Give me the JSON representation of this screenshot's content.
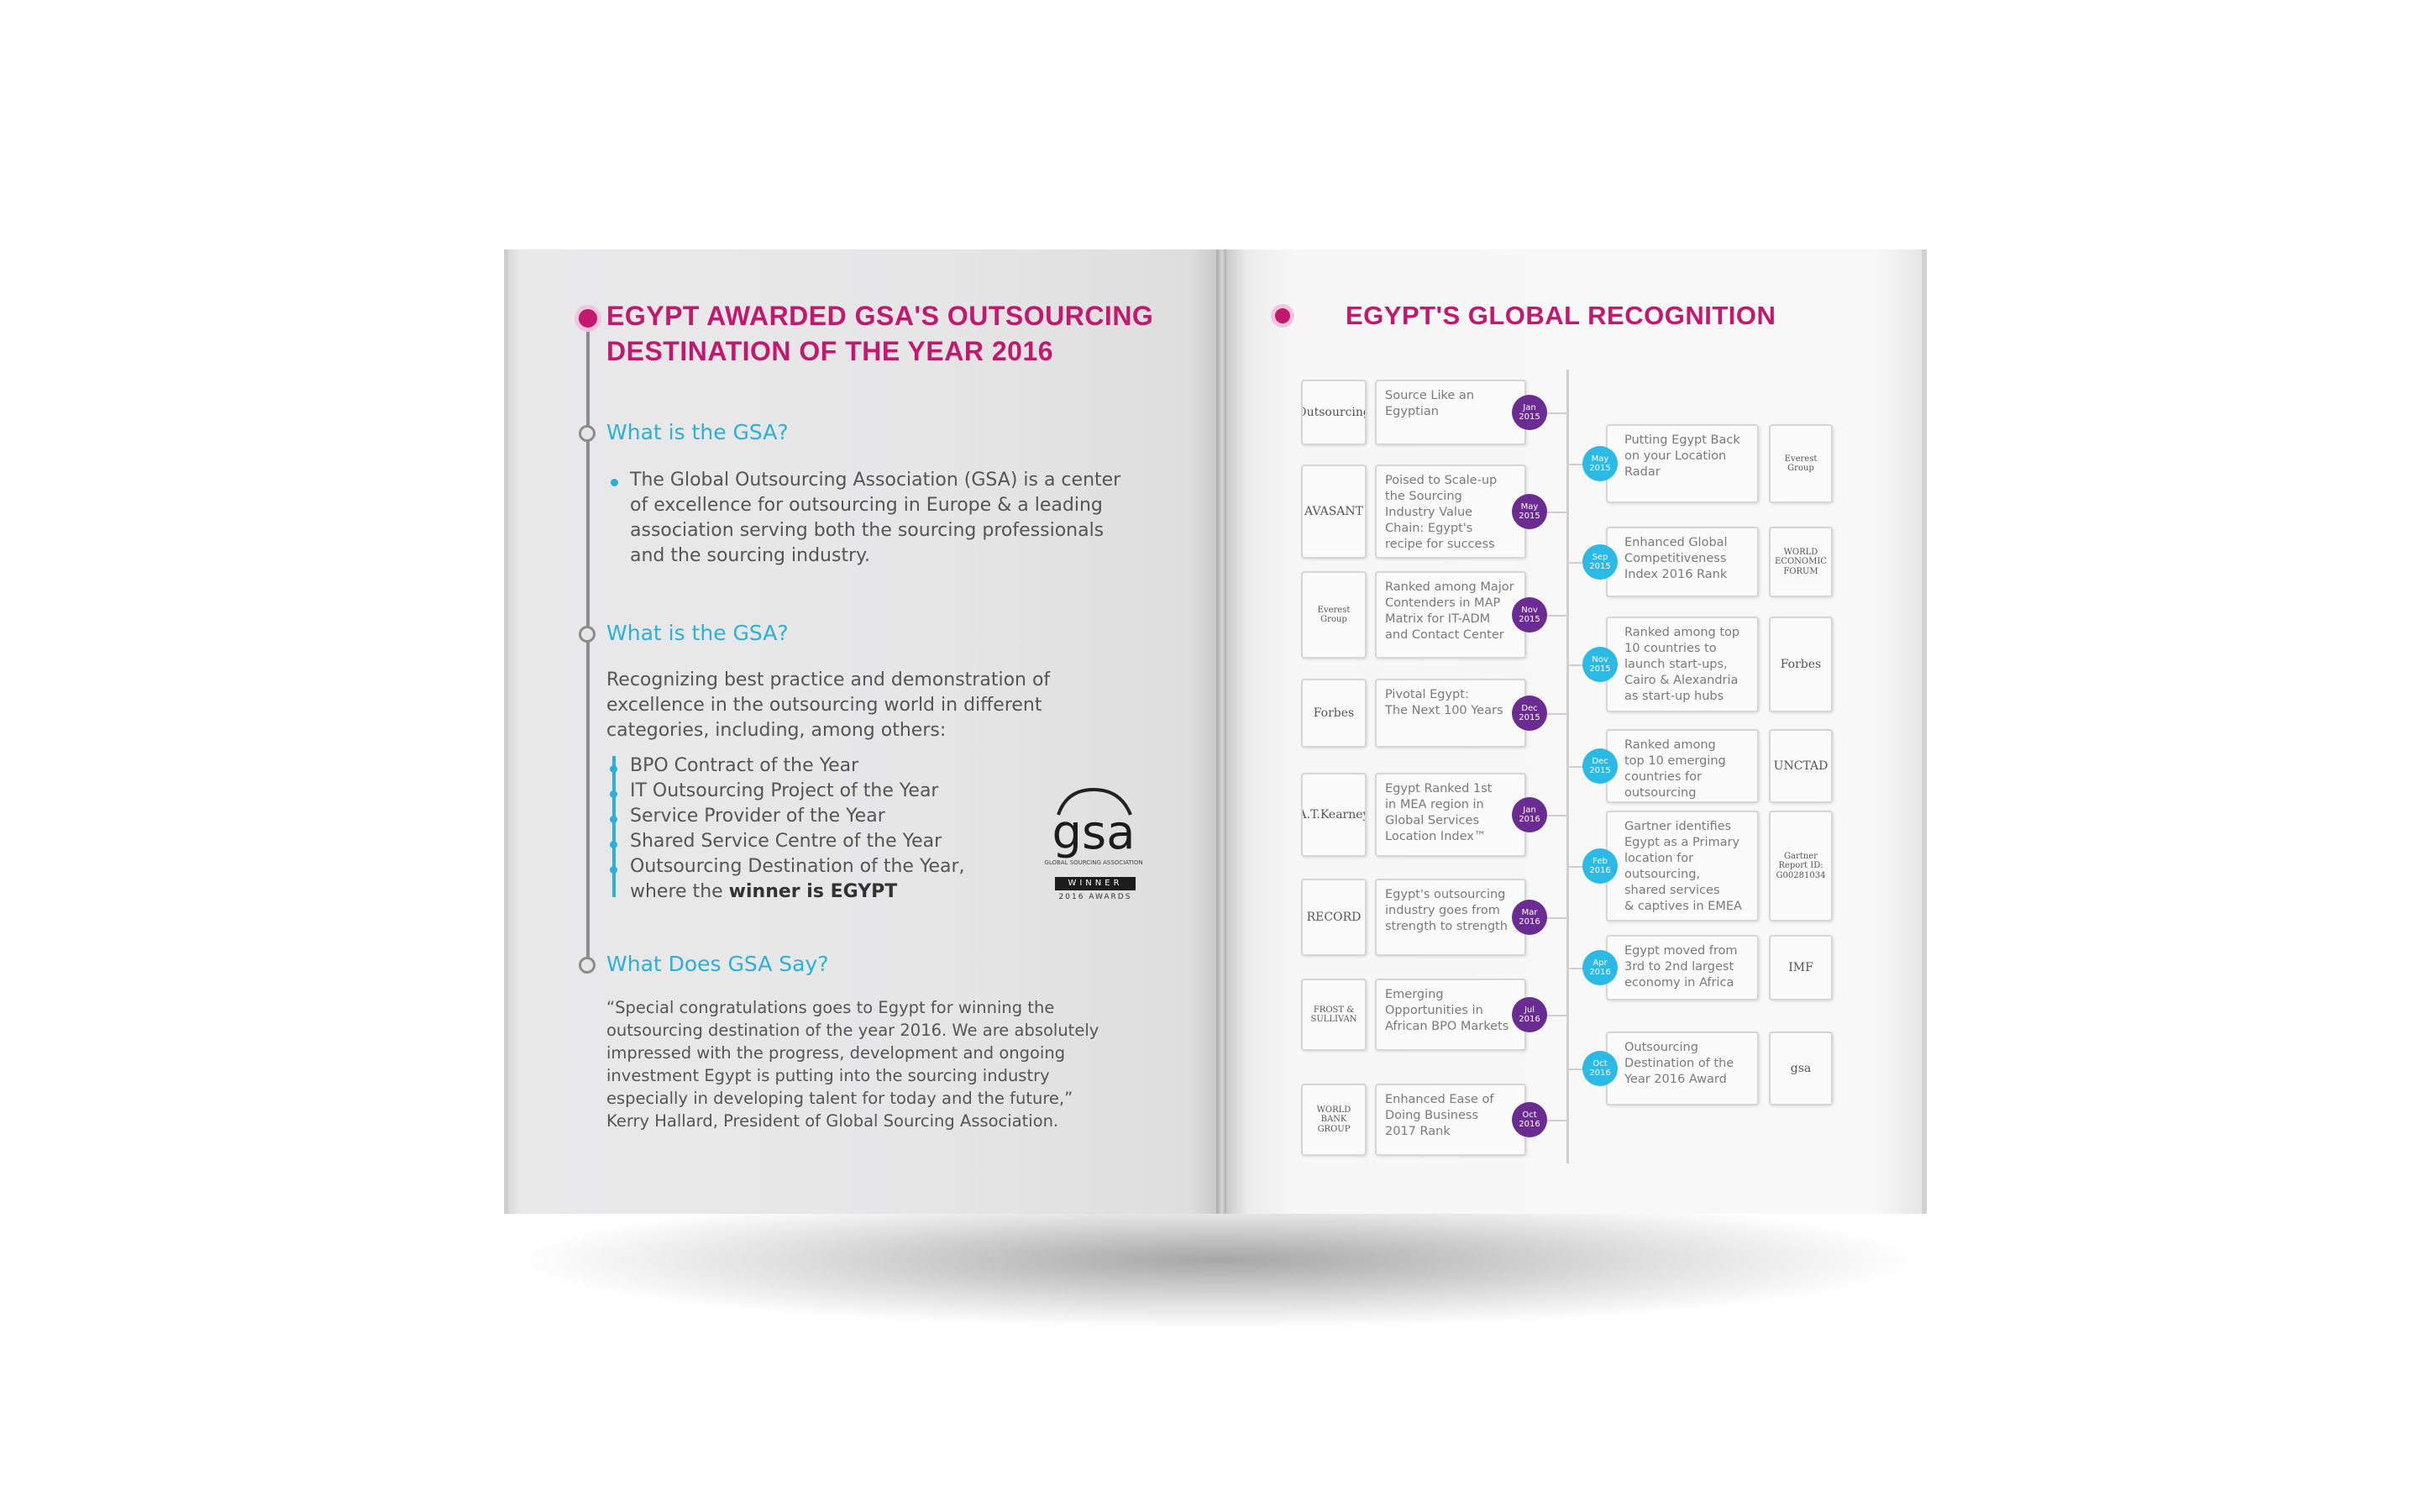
{
  "left_page": {
    "title_line1": "EGYPT AWARDED GSA'S OUTSOURCING",
    "title_line2": "DESTINATION OF THE YEAR 2016",
    "section1": {
      "heading": "What is the GSA?",
      "lines": [
        "The Global Outsourcing Association (GSA) is a center",
        "of excellence for outsourcing in Europe & a leading",
        "association serving both the sourcing professionals",
        "and the sourcing industry."
      ]
    },
    "section2": {
      "heading": "What is the GSA?",
      "intro_lines": [
        "Recognizing best practice and demonstration of",
        "excellence in the outsourcing world in different",
        "categories, including, among others:"
      ],
      "items": [
        "BPO Contract of the Year",
        "IT Outsourcing Project of the Year",
        "Service Provider of the Year",
        "Shared Service Centre of the Year",
        "Outsourcing Destination of the Year,"
      ],
      "last_line_prefix": "where the ",
      "last_line_bold": "winner is EGYPT"
    },
    "gsa_logo": {
      "mark": "gsa",
      "small_text": "GLOBAL SOURCING ASSOCIATION",
      "winner": "WINNER",
      "awards": "2016 AWARDS"
    },
    "section3": {
      "heading": "What Does GSA Say?",
      "quote_lines": [
        "“Special congratulations goes to Egypt for winning the",
        "outsourcing destination of the year 2016. We are absolutely",
        "impressed with the progress, development and ongoing",
        "investment Egypt is putting into the sourcing industry",
        "especially in developing talent for today and the future,”",
        "Kerry Hallard, President of Global Sourcing Association."
      ]
    }
  },
  "right_page": {
    "title": "EGYPT'S GLOBAL RECOGNITION",
    "left_column": [
      {
        "logo": "Outsourcing",
        "badge": [
          "Jan",
          "2015"
        ],
        "text": [
          "Source Like an",
          "Egyptian"
        ]
      },
      {
        "logo": "AVASANT",
        "badge": [
          "May",
          "2015"
        ],
        "text": [
          "Poised to Scale-up",
          "the Sourcing",
          "Industry Value",
          "Chain: Egypt's",
          "recipe for success"
        ]
      },
      {
        "logo": "Everest Group",
        "badge": [
          "Nov",
          "2015"
        ],
        "text": [
          "Ranked among Major",
          "Contenders in MAP",
          "Matrix for IT-ADM",
          "and Contact Center"
        ]
      },
      {
        "logo": "Forbes",
        "badge": [
          "Dec",
          "2015"
        ],
        "text": [
          "Pivotal Egypt:",
          "The Next 100 Years"
        ]
      },
      {
        "logo": "A.T.Kearney",
        "badge": [
          "Jan",
          "2016"
        ],
        "text": [
          "Egypt Ranked 1st",
          "in MEA region in",
          "Global Services",
          "Location Index™"
        ]
      },
      {
        "logo": "RECORD",
        "badge": [
          "Mar",
          "2016"
        ],
        "text": [
          "Egypt's outsourcing",
          "industry goes from",
          "strength to strength"
        ]
      },
      {
        "logo": "FROST & SULLIVAN",
        "badge": [
          "Jul",
          "2016"
        ],
        "text": [
          "Emerging",
          "Opportunities in",
          "African BPO Markets"
        ]
      },
      {
        "logo": "WORLD BANK GROUP",
        "badge": [
          "Oct",
          "2016"
        ],
        "text": [
          "Enhanced Ease of",
          "Doing Business",
          "2017 Rank"
        ]
      }
    ],
    "right_column": [
      {
        "logo": "Everest Group",
        "badge": [
          "May",
          "2015"
        ],
        "text": [
          "Putting Egypt Back",
          "on your Location",
          "Radar"
        ]
      },
      {
        "logo": "WORLD ECONOMIC FORUM",
        "badge": [
          "Sep",
          "2015"
        ],
        "text": [
          "Enhanced Global",
          "Competitiveness",
          "Index 2016 Rank"
        ]
      },
      {
        "logo": "Forbes",
        "badge": [
          "Nov",
          "2015"
        ],
        "text": [
          "Ranked among top",
          "10 countries to",
          "launch start-ups,",
          "Cairo & Alexandria",
          "as start-up hubs"
        ]
      },
      {
        "logo": "UNCTAD",
        "badge": [
          "Dec",
          "2015"
        ],
        "text": [
          "Ranked among",
          "top 10 emerging",
          "countries for",
          "outsourcing"
        ]
      },
      {
        "logo": "Gartner Report ID: G00281034",
        "badge": [
          "Feb",
          "2016"
        ],
        "text": [
          "Gartner identifies",
          "Egypt as a Primary",
          "location for",
          "outsourcing,",
          "shared services",
          "& captives in EMEA"
        ]
      },
      {
        "logo": "IMF",
        "badge": [
          "Apr",
          "2016"
        ],
        "text": [
          "Egypt moved from",
          "3rd to 2nd largest",
          "economy in Africa"
        ]
      },
      {
        "logo": "gsa",
        "badge": [
          "Oct",
          "2016"
        ],
        "text": [
          "Outsourcing",
          "Destination of the",
          "Year 2016 Award"
        ]
      }
    ]
  },
  "colors": {
    "magenta": "#c2186e",
    "cyan": "#2ab0d9",
    "purple_badge": "#6a2c91",
    "cyan_badge": "#2bb9e6"
  }
}
